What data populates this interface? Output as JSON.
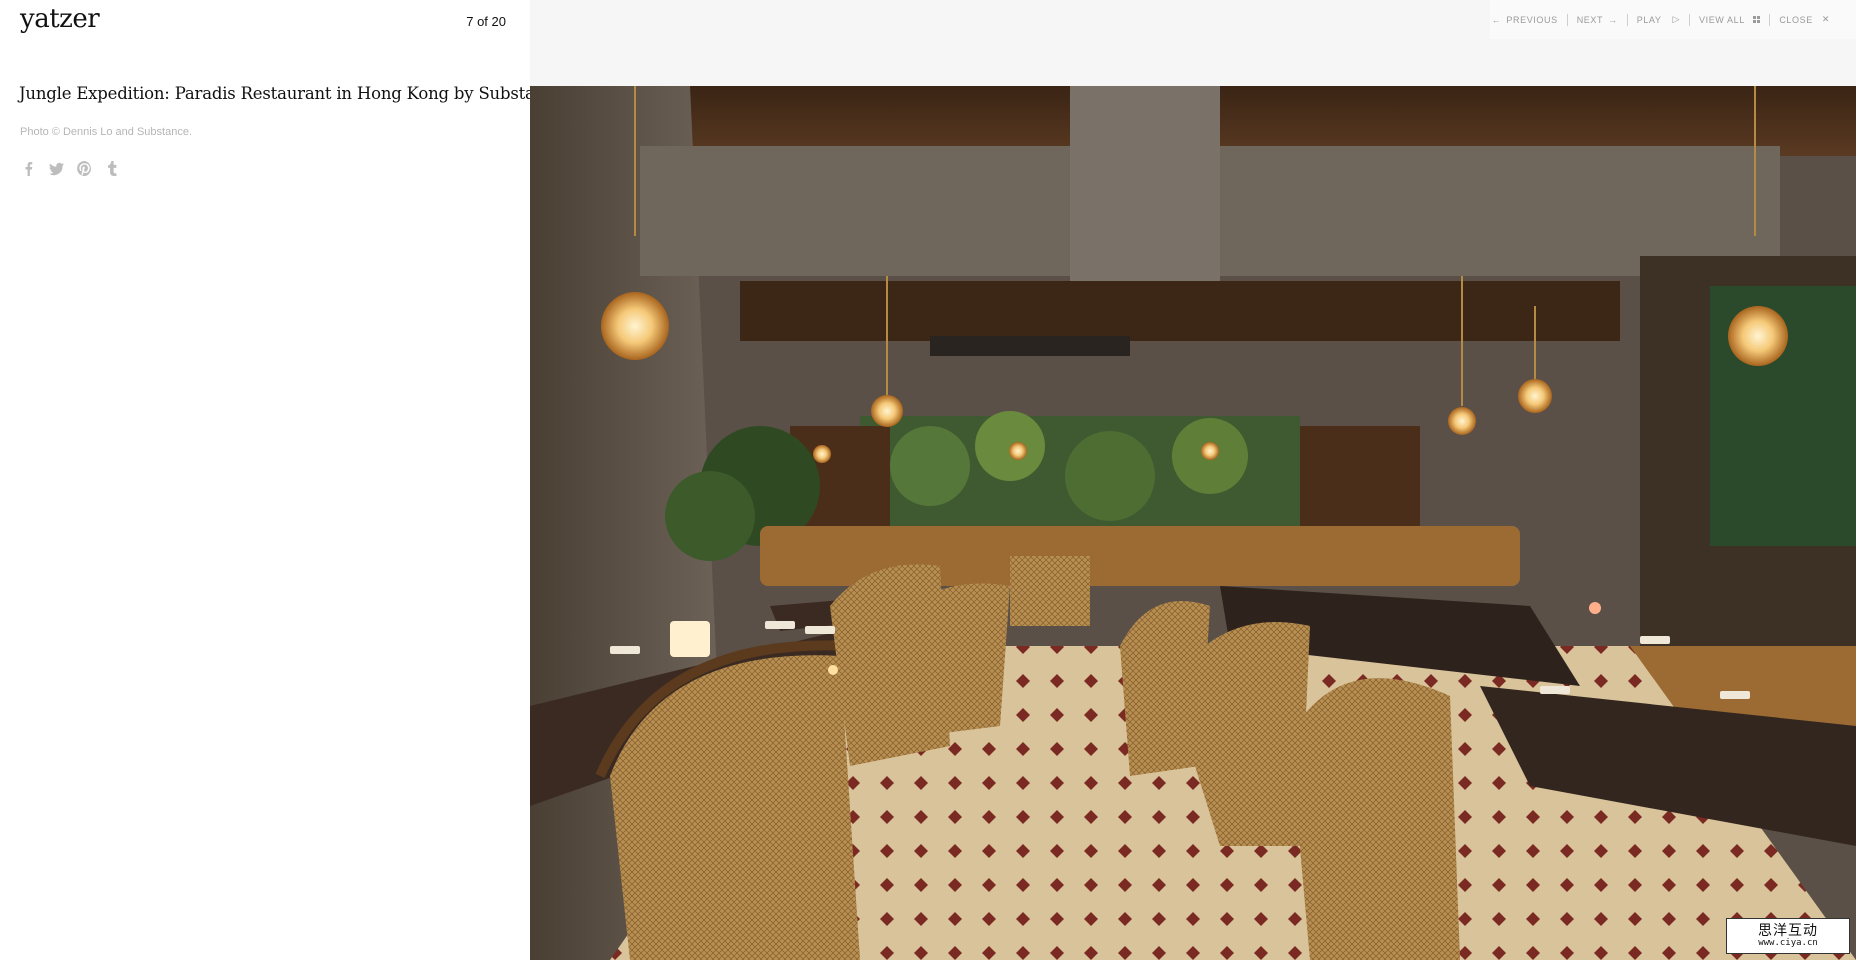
{
  "site": {
    "logo": "yatzer"
  },
  "gallery": {
    "counter": "7 of 20",
    "title": "Jungle Expedition: Paradis Restaurant in Hong Kong by Substance",
    "credit": "Photo © Dennis Lo and Substance."
  },
  "social": [
    {
      "name": "facebook-icon"
    },
    {
      "name": "twitter-icon"
    },
    {
      "name": "pinterest-icon"
    },
    {
      "name": "tumblr-icon"
    }
  ],
  "nav": {
    "previous": "PREVIOUS",
    "next": "NEXT",
    "play": "PLAY",
    "view_all": "VIEW ALL",
    "close": "CLOSE"
  },
  "photo": {
    "alt": "Paradis restaurant interior with rattan chairs, marble tables, pendant lamps and jungle mural"
  },
  "watermark": {
    "line1": "思洋互动",
    "line2": "www.ciya.cn"
  },
  "colors": {
    "text": "#111111",
    "muted": "#b5b5b5",
    "nav": "#9a9a9a",
    "viewer_bg": "#f6f6f6"
  }
}
